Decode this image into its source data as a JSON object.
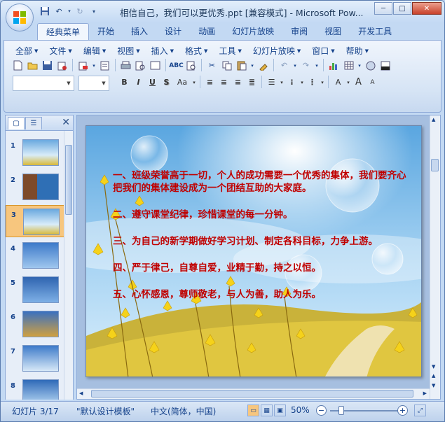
{
  "window": {
    "title": "相信自己，我们可以更优秀.ppt [兼容模式] - Microsoft Pow...",
    "controls": {
      "minimize": "─",
      "maximize": "□",
      "close": "✕"
    }
  },
  "ribbon_tabs": [
    "经典菜单",
    "开始",
    "插入",
    "设计",
    "动画",
    "幻灯片放映",
    "审阅",
    "视图",
    "开发工具"
  ],
  "menu": [
    "全部",
    "文件",
    "编辑",
    "视图",
    "插入",
    "格式",
    "工具",
    "幻灯片放映",
    "窗口",
    "帮助"
  ],
  "slide_panel": {
    "selected": 3,
    "thumbnails": [
      {
        "num": "1"
      },
      {
        "num": "2"
      },
      {
        "num": "3"
      },
      {
        "num": "4"
      },
      {
        "num": "5"
      },
      {
        "num": "6"
      },
      {
        "num": "7"
      },
      {
        "num": "8"
      }
    ]
  },
  "slide": {
    "lines": [
      "一、班级荣誉高于一切，个人的成功需要一个优秀的集体，我们要齐心把我们的集体建设成为一个团结互助的大家庭。",
      "二、遵守课堂纪律，珍惜课堂的每一分钟。",
      "三、为自己的新学期做好学习计划、制定各科目标，力争上游。",
      "四、严于律己，自尊自爱，业精于勤，持之以恒。",
      "五、心怀感恩，尊师敬老，与人为善，助人为乐。"
    ],
    "text_color": "#c00000"
  },
  "status": {
    "slide_info": "幻灯片 3/17",
    "template": "\"默认设计模板\"",
    "language": "中文(简体，中国)",
    "zoom": "50%",
    "zoom_level": 0.5
  }
}
